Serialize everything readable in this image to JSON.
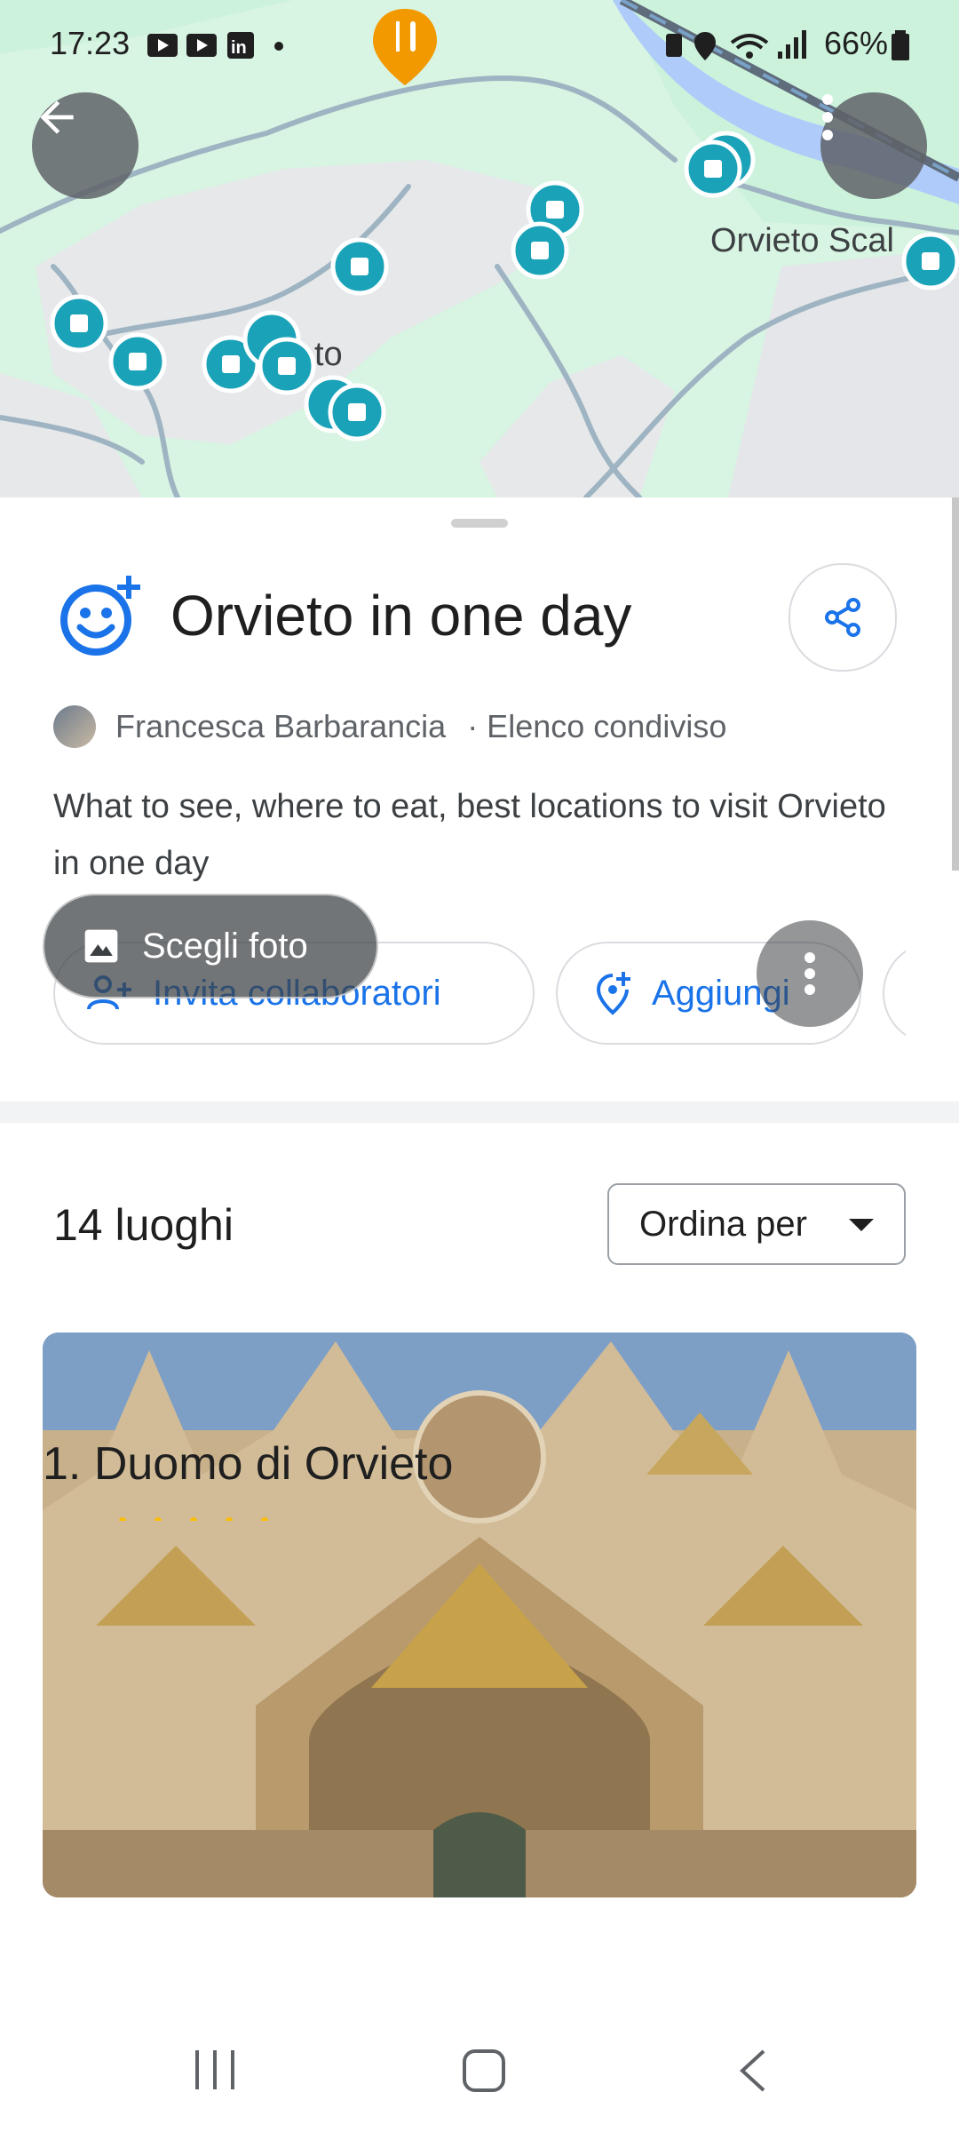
{
  "status_bar": {
    "time": "17:23",
    "battery": "66%"
  },
  "map": {
    "labels": {
      "orvieto_scalo": "Orvieto Scal",
      "orvieto_partial": "to"
    },
    "marker_color": "#1aa3b8",
    "restaurant_marker_color": "#f29900"
  },
  "list": {
    "title": "Orvieto in one day",
    "author": "Francesca Barbarancia",
    "list_type": "· Elenco condiviso",
    "description": "What to see, where to eat, best locations to visit Orvieto in one day",
    "actions": {
      "invite": "Invita collaboratori",
      "add": "Aggiungi"
    },
    "places_count": "14 luoghi",
    "sort_label": "Ordina per"
  },
  "place_card": {
    "choose_photo": "Scegli foto",
    "title": "1. Duomo di Orvieto"
  },
  "colors": {
    "accent": "#1a73e8",
    "map_green": "#ccf2dc",
    "map_road": "#9fb4c2"
  }
}
